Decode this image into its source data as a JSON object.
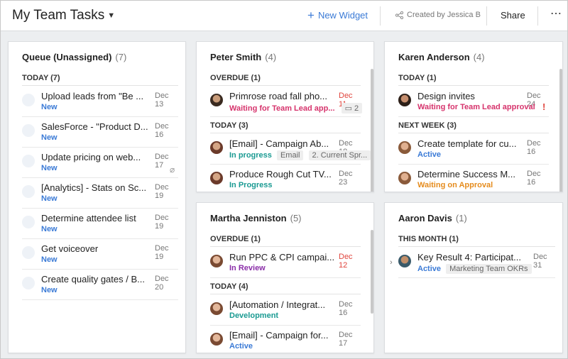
{
  "header": {
    "title": "My Team Tasks",
    "new_widget": "New Widget",
    "created_by": "Created by Jessica B",
    "share": "Share",
    "more": "⋯"
  },
  "colors": {
    "accent": "#3a7ad6",
    "red": "#e0443c",
    "green": "#1a9a92",
    "orange": "#e58b1c",
    "purple": "#8a2ea8",
    "pink": "#d6336c"
  },
  "queue": {
    "title": "Queue (Unassigned)",
    "count": "(7)",
    "section": "TODAY (7)",
    "tasks": [
      {
        "name": "Upload leads from \"Be ...",
        "date": "Dec 13",
        "status": "New"
      },
      {
        "name": "SalesForce - \"Product D...",
        "date": "Dec 16",
        "status": "New"
      },
      {
        "name": "Update pricing on web...",
        "date": "Dec 17",
        "status": "New"
      },
      {
        "name": "[Analytics] - Stats on Sc...",
        "date": "Dec 19",
        "status": "New"
      },
      {
        "name": "Determine attendee list",
        "date": "Dec 19",
        "status": "New"
      },
      {
        "name": "Get voiceover",
        "date": "Dec 19",
        "status": "New"
      },
      {
        "name": "Create quality gates / B...",
        "date": "Dec 20",
        "status": "New"
      }
    ]
  },
  "peter": {
    "title": "Peter Smith",
    "count": "(4)",
    "section1": "OVERDUE (1)",
    "section2": "TODAY (3)",
    "tasks": [
      {
        "name": "Primrose road fall pho...",
        "date": "Dec 11",
        "status": "Waiting for Team Lead app...",
        "extra": "2"
      },
      {
        "name": "[Email] - Campaign Ab...",
        "date": "Dec 18",
        "status": "In progress",
        "tag1": "Email",
        "tag2": "2. Current Spr..."
      },
      {
        "name": "Produce Rough Cut TV...",
        "date": "Dec 23",
        "status": "In Progress"
      }
    ]
  },
  "karen": {
    "title": "Karen Anderson",
    "count": "(4)",
    "section1": "TODAY (1)",
    "section2": "NEXT WEEK (3)",
    "tasks": [
      {
        "name": "Design invites",
        "date": "Dec 24",
        "status": "Waiting for Team Lead approval",
        "flag": "!"
      },
      {
        "name": "Create template for cu...",
        "date": "Dec 16",
        "status": "Active"
      },
      {
        "name": "Determine Success M...",
        "date": "Dec 16",
        "status": "Waiting on Approval"
      }
    ]
  },
  "martha": {
    "title": "Martha Jenniston",
    "count": "(5)",
    "section1": "OVERDUE (1)",
    "section2": "TODAY (4)",
    "tasks": [
      {
        "name": "Run PPC & CPI campai...",
        "date": "Dec 12",
        "status": "In Review"
      },
      {
        "name": "[Automation / Integrat...",
        "date": "Dec 16",
        "status": "Development"
      },
      {
        "name": "[Email] - Campaign for...",
        "date": "Dec 17",
        "status": "Active"
      }
    ]
  },
  "aaron": {
    "title": "Aaron Davis",
    "count": "(1)",
    "section1": "THIS MONTH (1)",
    "tasks": [
      {
        "name": "Key Result 4: Participat...",
        "date": "Dec 31",
        "status": "Active",
        "tag1": "Marketing Team OKRs"
      }
    ]
  }
}
